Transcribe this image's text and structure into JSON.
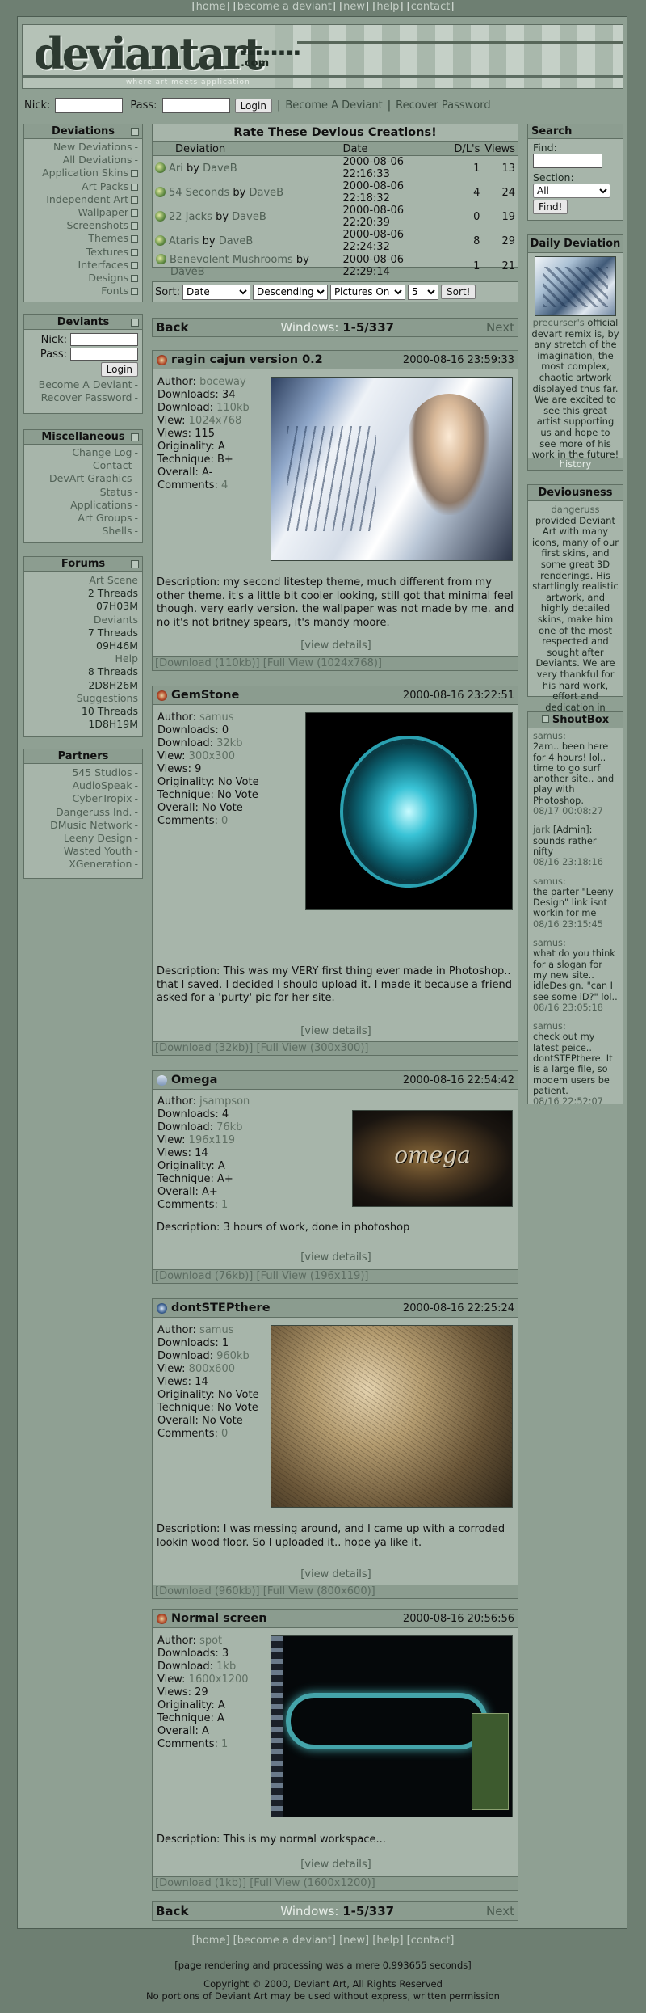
{
  "top_nav": [
    "home",
    "become a deviant",
    "new",
    "help",
    "contact"
  ],
  "banner": {
    "logo": "deviantart",
    "domain": ".com",
    "tagline": "where art meets application"
  },
  "login": {
    "nick_label": "Nick:",
    "pass_label": "Pass:",
    "button": "Login",
    "link1": "Become A Deviant",
    "link2": "Recover Password"
  },
  "left": {
    "deviations": {
      "title": "Deviations",
      "items": [
        {
          "label": "New Deviations",
          "end": "dash"
        },
        {
          "label": "All Deviations",
          "end": "dash"
        },
        {
          "label": "Application Skins",
          "end": "sq"
        },
        {
          "label": "Art Packs",
          "end": "sq"
        },
        {
          "label": "Independent Art",
          "end": "sq"
        },
        {
          "label": "Wallpaper",
          "end": "sq"
        },
        {
          "label": "Screenshots",
          "end": "sq"
        },
        {
          "label": "Themes",
          "end": "sq"
        },
        {
          "label": "Textures",
          "end": "sq"
        },
        {
          "label": "Interfaces",
          "end": "sq"
        },
        {
          "label": "Designs",
          "end": "sq"
        },
        {
          "label": "Fonts",
          "end": "sq"
        }
      ]
    },
    "deviants": {
      "title": "Deviants",
      "nick": "Nick:",
      "pass": "Pass:",
      "button": "Login",
      "link1": "Become A Deviant",
      "link2": "Recover Password"
    },
    "misc": {
      "title": "Miscellaneous",
      "items": [
        "Change Log",
        "Contact",
        "DevArt Graphics",
        "Status",
        "Applications",
        "Art Groups",
        "Shells"
      ]
    },
    "forums": {
      "title": "Forums",
      "items": [
        {
          "label": "Art Scene",
          "dark": false
        },
        {
          "label": "2 Threads",
          "dark": true
        },
        {
          "label": "07H03M",
          "dark": true
        },
        {
          "label": "Deviants",
          "dark": false
        },
        {
          "label": "7 Threads",
          "dark": true
        },
        {
          "label": "09H46M",
          "dark": true
        },
        {
          "label": "Help",
          "dark": false
        },
        {
          "label": "8 Threads",
          "dark": true
        },
        {
          "label": "2D8H26M",
          "dark": true
        },
        {
          "label": "Suggestions",
          "dark": false
        },
        {
          "label": "10 Threads",
          "dark": true
        },
        {
          "label": "1D8H19M",
          "dark": true
        }
      ]
    },
    "partners": {
      "title": "Partners",
      "items": [
        "545 Studios",
        "AudioSpeak",
        "CyberTropix",
        "Dangeruss Ind.",
        "DMusic Network",
        "Leeny Design",
        "Wasted Youth",
        "XGeneration"
      ]
    }
  },
  "rate": {
    "title": "Rate These Devious Creations!",
    "headers": [
      "Deviation",
      "Date",
      "D/L's",
      "Views"
    ],
    "rows": [
      {
        "name": "Ari",
        "author": "DaveB",
        "date": "2000-08-06 22:16:33",
        "dl": "1",
        "views": "13"
      },
      {
        "name": "54 Seconds",
        "author": "DaveB",
        "date": "2000-08-06 22:18:32",
        "dl": "4",
        "views": "24"
      },
      {
        "name": "22 Jacks",
        "author": "DaveB",
        "date": "2000-08-06 22:20:39",
        "dl": "0",
        "views": "19"
      },
      {
        "name": "Ataris",
        "author": "DaveB",
        "date": "2000-08-06 22:24:32",
        "dl": "8",
        "views": "29"
      },
      {
        "name": "Benevolent Mushrooms",
        "author": "DaveB",
        "date": "2000-08-06 22:29:14",
        "dl": "1",
        "views": "21"
      }
    ]
  },
  "sort": {
    "label": "Sort:",
    "field": "Date",
    "order": "Descending",
    "filter": "Pictures On",
    "count": "5",
    "button": "Sort!"
  },
  "pager": {
    "back": "Back",
    "windows_label": "Windows:",
    "range": "1-5/337",
    "next": "Next"
  },
  "labels": {
    "author": "Author:",
    "downloads": "Downloads:",
    "download": "Download:",
    "view": "View:",
    "views": "Views:",
    "originality": "Originality:",
    "technique": "Technique:",
    "overall": "Overall:",
    "comments": "Comments:",
    "description": "Description:",
    "view_details": "[view details]"
  },
  "deviations": [
    {
      "title": "ragin cajun version 0.2",
      "date": "2000-08-16 23:59:33",
      "author": "boceway",
      "downloads": "34",
      "download_size": "110kb",
      "view": "1024x768",
      "views": "115",
      "originality": "A",
      "technique": "B+",
      "overall": "A-",
      "comments": "4",
      "description": "my second litestep theme, much different from my other theme. it's a little bit cooler looking, still got that minimal feel though. very early version. the wallpaper was not made by me. and no it's not britney spears, it's mandy moore.",
      "dl_link": "[Download (110kb)]",
      "full_link": "[Full View (1024x768)]"
    },
    {
      "title": "GemStone",
      "date": "2000-08-16 23:22:51",
      "author": "samus",
      "downloads": "0",
      "download_size": "32kb",
      "view": "300x300",
      "views": "9",
      "originality": "No Vote",
      "technique": "No Vote",
      "overall": "No Vote",
      "comments": "0",
      "description": "This was my VERY first thing ever made in Photoshop.. that I saved. I decided I should upload it. I made it because a friend asked for a 'purty' pic for her site.",
      "dl_link": "[Download (32kb)]",
      "full_link": "[Full View (300x300)]"
    },
    {
      "title": "Omega",
      "date": "2000-08-16 22:54:42",
      "author": "jsampson",
      "downloads": "4",
      "download_size": "76kb",
      "view": "196x119",
      "views": "14",
      "originality": "A",
      "technique": "A+",
      "overall": "A+",
      "comments": "1",
      "description": "3 hours of work, done in photoshop",
      "thumb_text": "omega",
      "dl_link": "[Download (76kb)]",
      "full_link": "[Full View (196x119)]"
    },
    {
      "title": "dontSTEPthere",
      "date": "2000-08-16 22:25:24",
      "author": "samus",
      "downloads": "1",
      "download_size": "960kb",
      "view": "800x600",
      "views": "14",
      "originality": "No Vote",
      "technique": "No Vote",
      "overall": "No Vote",
      "comments": "0",
      "description": "I was messing around, and I came up with a corroded lookin wood floor. So I uploaded it.. hope ya like it.",
      "dl_link": "[Download (960kb)]",
      "full_link": "[Full View (800x600)]"
    },
    {
      "title": "Normal screen",
      "date": "2000-08-16 20:56:56",
      "author": "spot",
      "downloads": "3",
      "download_size": "1kb",
      "view": "1600x1200",
      "views": "29",
      "originality": "A",
      "technique": "A",
      "overall": "A",
      "comments": "1",
      "description": "This is my normal workspace...",
      "dl_link": "[Download (1kb)]",
      "full_link": "[Full View (1600x1200)]"
    }
  ],
  "right": {
    "search": {
      "title": "Search",
      "find": "Find:",
      "section": "Section:",
      "section_value": "All",
      "button": "Find!"
    },
    "daily": {
      "title": "Daily Deviation",
      "text_link": "precurser's",
      "text": " official devart remix is, by any stretch of the imagination, the most complex, chaotic artwork displayed thus far. We are excited to see this great artist supporting us and hope to see more of his work in the future!",
      "history": "history"
    },
    "deviousness": {
      "title": "Deviousness",
      "name": "dangeruss",
      "text": " provided Deviant Art with many icons, many of our first skins, and some great 3D renderings. His startlingly realistic artwork, and highly detailed skins, make him one of the most respected and sought after Deviants. We are very thankful for his hard work, effort and dedication in helping get Deviant Art off the ground."
    },
    "shoutbox": {
      "title": "ShoutBox",
      "posts": [
        {
          "user": "samus",
          "text": "2am.. been here for 4 hours! lol.. time to go surf another site.. and play with Photoshop.",
          "time": "08/17 00:08:27"
        },
        {
          "user": "jark",
          "role": " [Admin]:",
          "text": "sounds rather nifty",
          "time": "08/16 23:18:16"
        },
        {
          "user": "samus",
          "text": "the parter \"Leeny Design\" link isnt workin for me",
          "time": "08/16 23:15:45"
        },
        {
          "user": "samus",
          "text": "what do you think for a slogan for my new site.. idleDesign. \"can I see some iD?\" lol..",
          "time": "08/16 23:05:18"
        },
        {
          "user": "samus",
          "text": "check out my latest peice.. dontSTEPthere. It is a large file, so modem users be patient.",
          "time": "08/16 22:52:07"
        }
      ]
    }
  },
  "footer": {
    "render": "[page rendering and processing was a mere 0.993655 seconds]",
    "copyright": "Copyright © 2000, Deviant Art, All Rights Reserved",
    "notice": "No portions of Deviant Art may be used without express, written permission"
  }
}
